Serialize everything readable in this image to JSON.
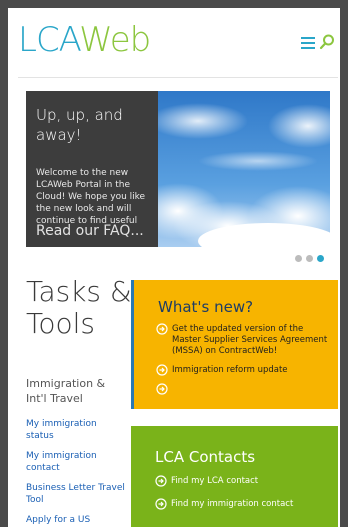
{
  "header": {
    "logo_lca": "LCA",
    "logo_web": "Web"
  },
  "hero": {
    "title": "Up, up, and away!",
    "text": "Welcome to the new LCAWeb Portal in the Cloud! We hope you like the new look and will continue to find useful",
    "link": "Read our FAQ..."
  },
  "carousel": {
    "slides": 3,
    "active": 3
  },
  "tasks": {
    "title": "Tasks & Tools",
    "category": "Immigration & Int'l Travel",
    "links": [
      "My immigration status",
      "My immigration contact",
      "Business Letter Travel Tool",
      "Apply for a US"
    ]
  },
  "whats_new": {
    "title": "What's new?",
    "items": [
      "Get the updated version of the Master Supplier Services Agreement (MSSA) on ContractWeb!",
      "Immigration reform update",
      ""
    ]
  },
  "contacts": {
    "title": "LCA Contacts",
    "items": [
      "Find my LCA contact",
      "Find my immigration contact"
    ]
  },
  "colors": {
    "brand_blue": "#2aa6c9",
    "brand_green": "#8cc63f",
    "whats_new_bg": "#f7b400",
    "contacts_bg": "#7ab31a",
    "hero_panel": "#3d3d3d"
  }
}
